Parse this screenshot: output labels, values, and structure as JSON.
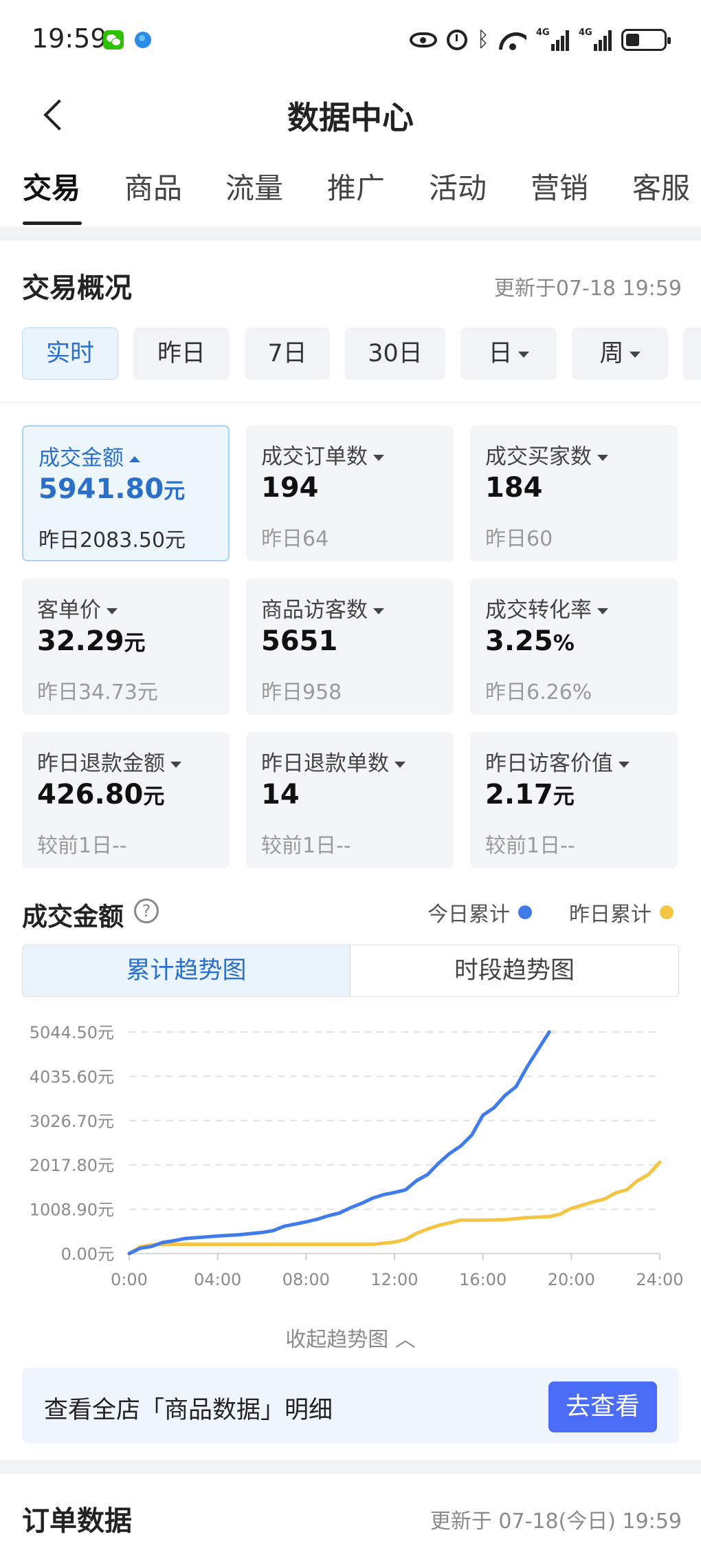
{
  "status_bar": {
    "time": "19:59",
    "signal1": "4G",
    "signal2": "4G",
    "battery_level": 0.35
  },
  "header": {
    "title": "数据中心"
  },
  "tabs": [
    "交易",
    "商品",
    "流量",
    "推广",
    "活动",
    "营销",
    "客服"
  ],
  "overview": {
    "title": "交易概况",
    "updated": "更新于07-18 19:59",
    "periods": [
      "实时",
      "昨日",
      "7日",
      "30日",
      "日",
      "周"
    ],
    "metrics": [
      {
        "label": "成交金额",
        "value": "5941.80",
        "unit": "元",
        "sub": "昨日2083.50元"
      },
      {
        "label": "成交订单数",
        "value": "194",
        "unit": "",
        "sub": "昨日64"
      },
      {
        "label": "成交买家数",
        "value": "184",
        "unit": "",
        "sub": "昨日60"
      },
      {
        "label": "客单价",
        "value": "32.29",
        "unit": "元",
        "sub": "昨日34.73元"
      },
      {
        "label": "商品访客数",
        "value": "5651",
        "unit": "",
        "sub": "昨日958"
      },
      {
        "label": "成交转化率",
        "value": "3.25",
        "unit": "%",
        "sub": "昨日6.26%"
      },
      {
        "label": "昨日退款金额",
        "value": "426.80",
        "unit": "元",
        "sub": "较前1日--"
      },
      {
        "label": "昨日退款单数",
        "value": "14",
        "unit": "",
        "sub": "较前1日--"
      },
      {
        "label": "昨日访客价值",
        "value": "2.17",
        "unit": "元",
        "sub": "较前1日--"
      }
    ]
  },
  "chart_section": {
    "title": "成交金额",
    "help_symbol": "?",
    "legend": [
      {
        "label": "今日累计",
        "color": "#3f7bea"
      },
      {
        "label": "昨日累计",
        "color": "#f6c443"
      }
    ],
    "toggle": [
      "累计趋势图",
      "时段趋势图"
    ],
    "collapse": "收起趋势图"
  },
  "chart_data": {
    "type": "line",
    "x_ticks": [
      "0:00",
      "04:00",
      "08:00",
      "12:00",
      "16:00",
      "20:00",
      "24:00"
    ],
    "y_ticks": [
      "0.00元",
      "1008.90元",
      "2017.80元",
      "3026.70元",
      "4035.60元",
      "5044.50元"
    ],
    "ylim": [
      0,
      5044.5
    ],
    "xlim": [
      0,
      24
    ],
    "grid": true,
    "series": [
      {
        "name": "今日累计",
        "color": "#3f7bea",
        "x": [
          0,
          0.5,
          1,
          1.5,
          2,
          2.5,
          3,
          4,
          5,
          6,
          6.5,
          7,
          8,
          8.5,
          9,
          9.5,
          10,
          10.5,
          11,
          11.5,
          12,
          12.5,
          13,
          13.5,
          14,
          14.5,
          15,
          15.5,
          16,
          16.5,
          17,
          17.5,
          18,
          18.5,
          19
        ],
        "y": [
          0,
          120,
          160,
          250,
          290,
          340,
          360,
          400,
          430,
          480,
          520,
          620,
          720,
          780,
          860,
          920,
          1040,
          1140,
          1260,
          1340,
          1390,
          1450,
          1660,
          1800,
          2060,
          2280,
          2450,
          2700,
          3150,
          3320,
          3600,
          3800,
          4250,
          4650,
          5044
        ]
      },
      {
        "name": "昨日累计",
        "color": "#f6c443",
        "x": [
          0,
          0.5,
          1,
          2,
          4,
          8,
          11,
          12,
          12.5,
          13,
          13.5,
          14,
          14.5,
          15,
          16,
          17,
          18,
          19,
          19.5,
          20,
          20.5,
          21,
          21.5,
          22,
          22.5,
          23,
          23.5,
          24
        ],
        "y": [
          0,
          150,
          200,
          210,
          210,
          210,
          210,
          260,
          320,
          460,
          560,
          640,
          700,
          760,
          760,
          770,
          820,
          840,
          900,
          1030,
          1100,
          1180,
          1240,
          1380,
          1450,
          1660,
          1800,
          2080
        ]
      }
    ]
  },
  "banner": {
    "text": "查看全店「商品数据」明细",
    "button": "去查看"
  },
  "orders": {
    "title": "订单数据",
    "updated": "更新于 07-18(今日) 19:59"
  }
}
